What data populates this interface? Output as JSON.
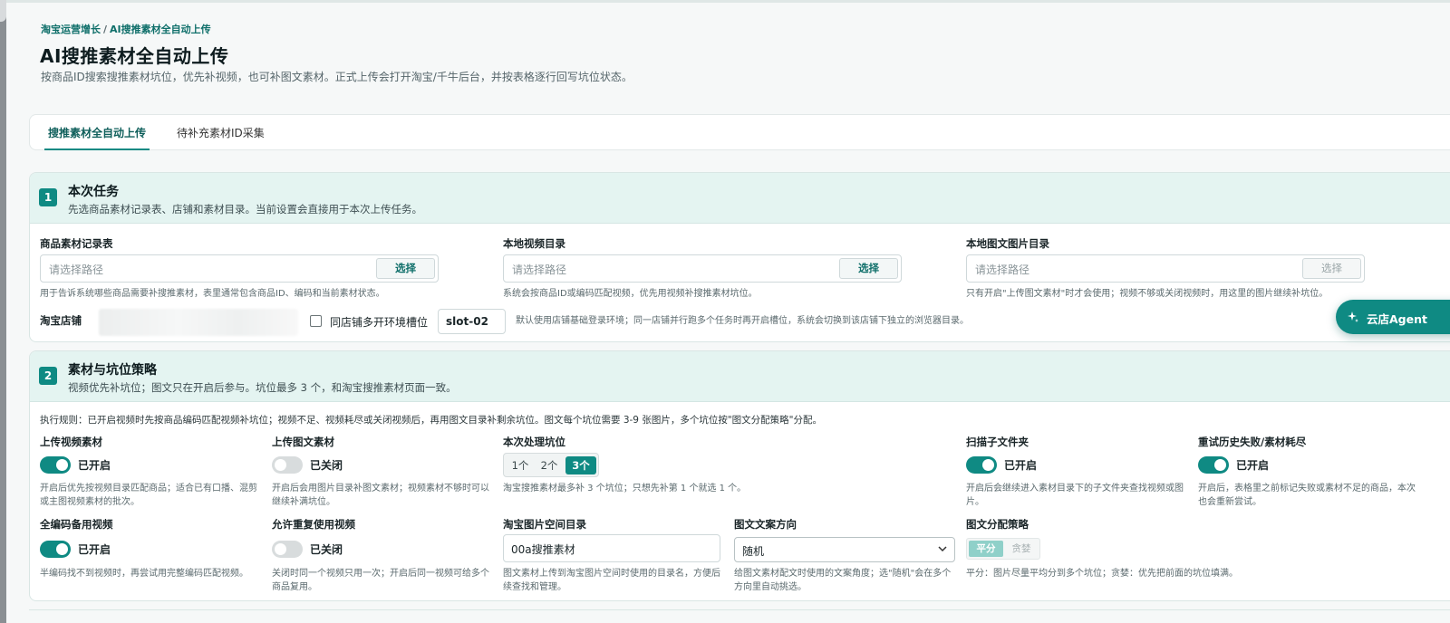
{
  "breadcrumb": {
    "parent": "淘宝运营增长",
    "separator": "/",
    "current": "AI搜推素材全自动上传"
  },
  "page": {
    "title": "AI搜推素材全自动上传",
    "subtitle": "按商品ID搜索搜推素材坑位，优先补视频，也可补图文素材。正式上传会打开淘宝/千牛后台，并按表格逐行回写坑位状态。"
  },
  "tabs": [
    {
      "label": "搜推素材全自动上传",
      "active": true
    },
    {
      "label": "待补充素材ID采集",
      "active": false
    }
  ],
  "section1": {
    "number": "1",
    "title": "本次任务",
    "subtitle": "先选商品素材记录表、店铺和素材目录。当前设置会直接用于本次上传任务。",
    "record_table": {
      "label": "商品素材记录表",
      "placeholder": "请选择路径",
      "button": "选择",
      "help": "用于告诉系统哪些商品需要补搜推素材，表里通常包含商品ID、编码和当前素材状态。"
    },
    "video_dir": {
      "label": "本地视频目录",
      "placeholder": "请选择路径",
      "button": "选择",
      "help": "系统会按商品ID或编码匹配视频，优先用视频补搜推素材坑位。"
    },
    "image_dir": {
      "label": "本地图文图片目录",
      "placeholder": "请选择路径",
      "button": "选择",
      "help": "只有开启\"上传图文素材\"时才会使用；视频不够或关闭视频时，用这里的图片继续补坑位。"
    },
    "shop": {
      "label": "淘宝店铺",
      "multi_env_label": "同店铺多开环境槽位",
      "multi_env_checked": false,
      "slot_value": "slot-02",
      "help": "默认使用店铺基础登录环境；同一店铺并行跑多个任务时再开启槽位，系统会切换到该店铺下独立的浏览器目录。"
    }
  },
  "section2": {
    "number": "2",
    "title": "素材与坑位策略",
    "subtitle": "视频优先补坑位；图文只在开启后参与。坑位最多 3 个，和淘宝搜推素材页面一致。",
    "rule": "执行规则：已开启视频时先按商品编码匹配视频补坑位；视频不足、视频耗尽或关闭视频后，再用图文目录补剩余坑位。图文每个坑位需要 3-9 张图片，多个坑位按\"图文分配策略\"分配。",
    "upload_video": {
      "label": "上传视频素材",
      "state": "已开启",
      "on": true,
      "help": "开启后优先按视频目录匹配商品；适合已有口播、混剪或主图视频素材的批次。"
    },
    "upload_image": {
      "label": "上传图文素材",
      "state": "已关闭",
      "on": false,
      "help": "开启后会用图片目录补图文素材；视频素材不够时可以继续补满坑位。"
    },
    "slots": {
      "label": "本次处理坑位",
      "options": [
        "1个",
        "2个",
        "3个"
      ],
      "selected": "3个",
      "help": "淘宝搜推素材最多补 3 个坑位；只想先补第 1 个就选 1 个。"
    },
    "scan_subfolders": {
      "label": "扫描子文件夹",
      "state": "已开启",
      "on": true,
      "help": "开启后会继续进入素材目录下的子文件夹查找视频或图片。"
    },
    "retry_failed": {
      "label": "重试历史失败/素材耗尽",
      "state": "已开启",
      "on": true,
      "help": "开启后，表格里之前标记失败或素材不足的商品，本次也会重新尝试。"
    },
    "full_code_backup": {
      "label": "全编码备用视频",
      "state": "已开启",
      "on": true,
      "help": "半编码找不到视频时，再尝试用完整编码匹配视频。"
    },
    "allow_reuse": {
      "label": "允许重复使用视频",
      "state": "已关闭",
      "on": false,
      "help": "关闭时同一个视频只用一次；开启后同一视频可给多个商品复用。"
    },
    "image_space_dir": {
      "label": "淘宝图片空间目录",
      "value": "00a搜推素材",
      "help": "图文素材上传到淘宝图片空间时使用的目录名，方便后续查找和管理。"
    },
    "copy_direction": {
      "label": "图文文案方向",
      "value": "随机",
      "help": "给图文素材配文时使用的文案角度；选\"随机\"会在多个方向里自动挑选。"
    },
    "distribution": {
      "label": "图文分配策略",
      "options": [
        "平分",
        "贪婪"
      ],
      "selected": "平分",
      "help": "平分：图片尽量平均分到多个坑位；贪婪：优先把前面的坑位填满。"
    }
  },
  "agent_button": {
    "label": "云店Agent",
    "icon": "sparkle-icon"
  },
  "colors": {
    "accent": "#0f8a83",
    "section_header_bg": "#e4f4f1",
    "toggle_off": "#d8dcdd"
  }
}
